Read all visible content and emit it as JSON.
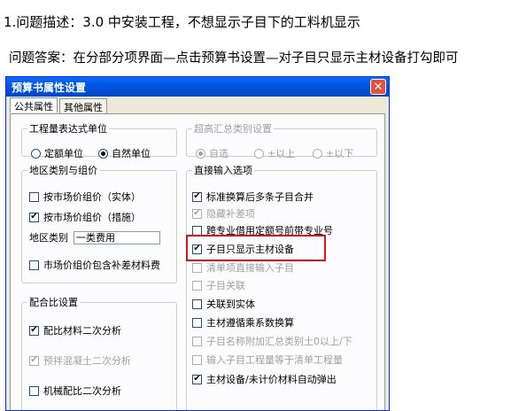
{
  "question": "1.问题描述：3.0 中安装工程，不想显示子目下的工料机显示",
  "answer": "问题答案：在分部分项界面—点击预算书设置—对子目只显示主材设备打勾即可",
  "window": {
    "title": "预算书属性设置",
    "close_symbol": "✕",
    "tabs": [
      {
        "label": "公共属性",
        "active": true
      },
      {
        "label": "其他属性",
        "active": false
      }
    ]
  },
  "groups": {
    "expr_unit": {
      "legend": "工程量表达式单位",
      "options": [
        {
          "label": "定额单位",
          "selected": false
        },
        {
          "label": "自然单位",
          "selected": true
        }
      ]
    },
    "region": {
      "legend": "地区类别与组价",
      "items": [
        {
          "label": "按市场价组价（实体）",
          "checked": false
        },
        {
          "label": "按市场价组价（措施）",
          "checked": true
        }
      ],
      "region_label": "地区类别",
      "region_value": "一类费用",
      "diff_item": {
        "label": "市场价组价包含补差材料费",
        "checked": false
      }
    },
    "mix": {
      "legend": "配合比设置",
      "items": [
        {
          "label": "配比材料二次分析",
          "checked": true,
          "disabled": false
        },
        {
          "label": "预拌混凝土二次分析",
          "checked": true,
          "disabled": true
        },
        {
          "label": "机械配比二次分析",
          "checked": false,
          "disabled": false
        }
      ]
    },
    "overhigh": {
      "legend": "超高汇总类别设置",
      "options": [
        {
          "label": "自选",
          "selected": true
        },
        {
          "label": "±以上",
          "selected": false
        },
        {
          "label": "±以下",
          "selected": false
        }
      ]
    },
    "direct": {
      "legend": "直接输入选项",
      "items": [
        {
          "label": "标准换算后多条子目合并",
          "checked": true,
          "disabled": false
        },
        {
          "label": "隐藏补差项",
          "checked": true,
          "disabled": true
        },
        {
          "label": "跨专业借用定额号前带专业号",
          "checked": false,
          "disabled": false
        },
        {
          "label": "子目只显示主材设备",
          "checked": true,
          "disabled": false
        },
        {
          "label": "清单项直接输入子目",
          "checked": false,
          "disabled": true
        },
        {
          "label": "子目关联",
          "checked": false,
          "disabled": true
        },
        {
          "label": "关联到实体",
          "checked": false,
          "disabled": false
        },
        {
          "label": "主材遵循乘系数换算",
          "checked": false,
          "disabled": false
        },
        {
          "label": "子目名称附加汇总类别土0以上/下",
          "checked": false,
          "disabled": true
        },
        {
          "label": "输入子目工程量等于清单工程量",
          "checked": false,
          "disabled": true
        },
        {
          "label": "主材设备/未计价材料自动弹出",
          "checked": true,
          "disabled": false
        }
      ]
    }
  },
  "colors": {
    "titlebar": "#0054e3",
    "highlight": "#e0111b"
  },
  "icons": {
    "check": "✔",
    "close": "close-icon"
  }
}
